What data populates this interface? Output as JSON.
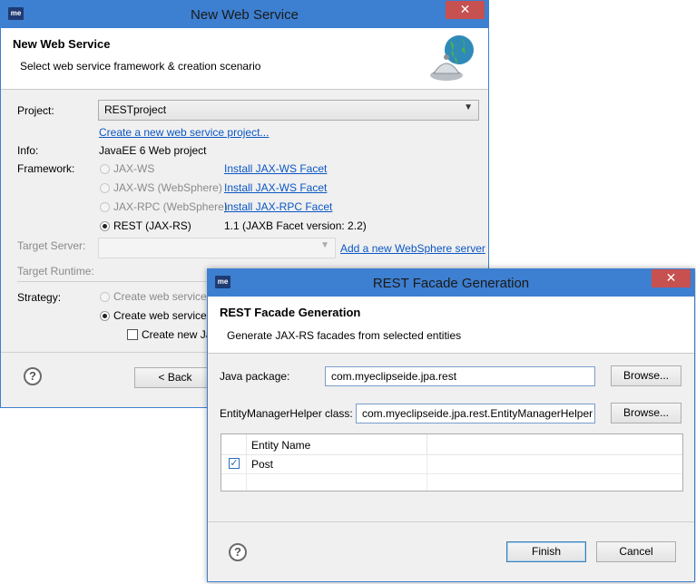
{
  "back_dialog": {
    "title": "New Web Service",
    "header_title": "New Web Service",
    "header_subtitle": "Select web service framework & creation scenario",
    "project_label": "Project:",
    "project_value": "RESTproject",
    "create_project_link": "Create a new web service project...",
    "info_label": "Info:",
    "info_value": "JavaEE 6 Web project",
    "framework_label": "Framework:",
    "frameworks": [
      {
        "label": "JAX-WS",
        "link": "Install JAX-WS Facet"
      },
      {
        "label": "JAX-WS (WebSphere)",
        "link": "Install JAX-WS Facet"
      },
      {
        "label": "JAX-RPC (WebSphere)",
        "link": "Install JAX-RPC Facet"
      },
      {
        "label": "REST (JAX-RS)",
        "note": "1.1 (JAXB Facet version: 2.2)"
      }
    ],
    "target_server_label": "Target Server:",
    "add_server_link": "Add a new WebSphere server",
    "target_runtime_label": "Target Runtime:",
    "strategy_label": "Strategy:",
    "strategies": [
      "Create web service f",
      "Create web service f"
    ],
    "create_new_label": "Create new Jav",
    "back_button": "< Back",
    "help": "?",
    "close": "✕"
  },
  "front_dialog": {
    "title": "REST Facade Generation",
    "header_title": "REST Facade Generation",
    "header_subtitle": "Generate JAX-RS facades from selected entities",
    "java_package_label": "Java package:",
    "java_package_value": "com.myeclipseide.jpa.rest",
    "browse_label": "Browse...",
    "emh_label": "EntityManagerHelper class:",
    "emh_value": "com.myeclipseide.jpa.rest.EntityManagerHelper",
    "table": {
      "column_header": "Entity Name",
      "rows": [
        {
          "name": "Post",
          "checked": true
        }
      ]
    },
    "finish_button": "Finish",
    "cancel_button": "Cancel",
    "help": "?",
    "close": "✕"
  },
  "app_icon_text": "me",
  "colors": {
    "titlebar": "#3d7fd0",
    "close": "#c75050",
    "link": "#0b57c5"
  }
}
